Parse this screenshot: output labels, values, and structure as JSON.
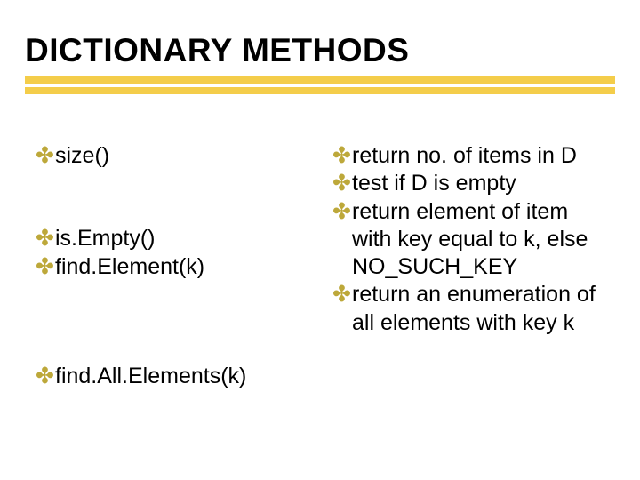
{
  "title": "DICTIONARY METHODS",
  "bullet_char": "✤",
  "left": {
    "items": [
      "size()",
      "is.Empty()",
      "find.Element(k)",
      "find.All.Elements(k)"
    ]
  },
  "right": {
    "items": [
      "return no. of items in D",
      "test if D is empty",
      "return element of item with key equal to k, else NO_SUCH_KEY",
      "return an enumeration of all elements with key k"
    ]
  }
}
